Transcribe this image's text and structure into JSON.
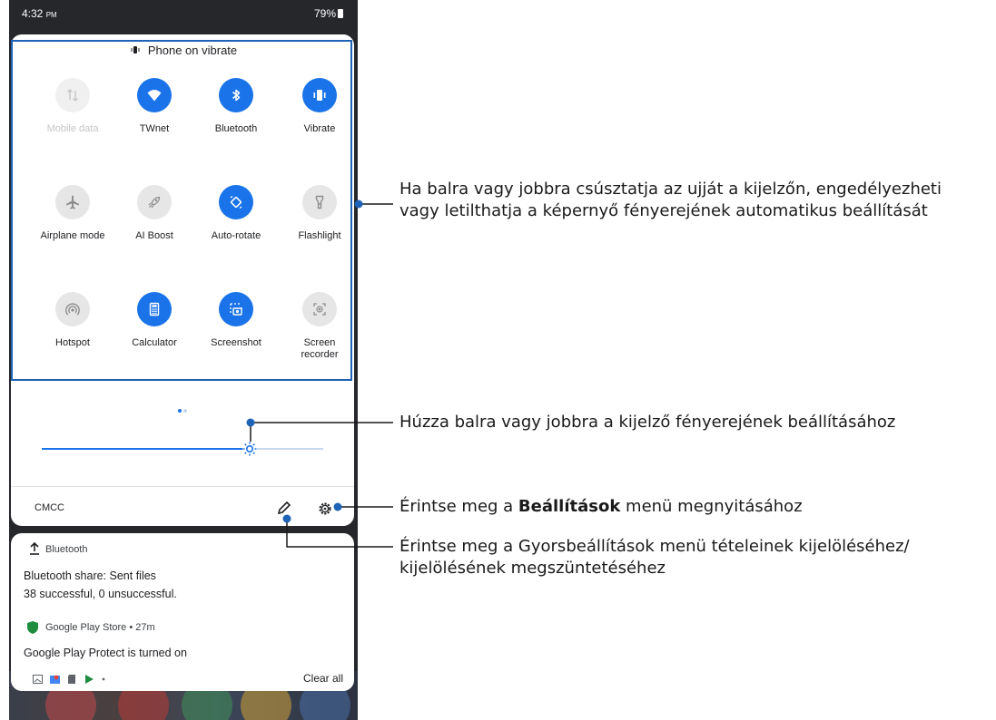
{
  "status_bar": {
    "time": "4:32",
    "ampm": "PM",
    "battery": "79%"
  },
  "quick_settings": {
    "mode_text": "Phone on vibrate",
    "tiles": [
      {
        "label": "Mobile data",
        "icon": "mobile-data-icon",
        "state": "disabled"
      },
      {
        "label": "TWnet",
        "icon": "wifi-icon",
        "state": "on"
      },
      {
        "label": "Bluetooth",
        "icon": "bluetooth-icon",
        "state": "on"
      },
      {
        "label": "Vibrate",
        "icon": "vibrate-icon",
        "state": "on"
      },
      {
        "label": "Airplane mode",
        "icon": "airplane-icon",
        "state": "off"
      },
      {
        "label": "AI Boost",
        "icon": "rocket-icon",
        "state": "off"
      },
      {
        "label": "Auto-rotate",
        "icon": "auto-rotate-icon",
        "state": "on"
      },
      {
        "label": "Flashlight",
        "icon": "flashlight-icon",
        "state": "off"
      },
      {
        "label": "Hotspot",
        "icon": "hotspot-icon",
        "state": "off"
      },
      {
        "label": "Calculator",
        "icon": "calculator-icon",
        "state": "on"
      },
      {
        "label": "Screenshot",
        "icon": "screenshot-icon",
        "state": "on"
      },
      {
        "label": "Screen recorder",
        "icon": "screen-recorder-icon",
        "state": "off"
      }
    ],
    "page_count": 2,
    "current_page": 1,
    "brightness_level": 0.74,
    "carrier": "CMCC"
  },
  "notifications": {
    "bt_app": "Bluetooth",
    "bt_title": "Bluetooth share: Sent files",
    "bt_text": "38 successful, 0 unsuccessful.",
    "gp_app": "Google Play Store • 27m",
    "gp_title": "Google Play Protect is turned on",
    "clear_all": "Clear all"
  },
  "annotations": {
    "swipe_line1": "Ha balra vagy jobbra csúsztatja az ujját a kijelzőn, engedélyezheti",
    "swipe_line2": "vagy letilthatja a képernyő fényerejének automatikus beállítását",
    "brightness": "Húzza balra vagy jobbra a kijelző fényerejének beállításához",
    "settings_pre": "Érintse meg a ",
    "settings_bold": "Beállítások",
    "settings_post": " menü megnyitásához",
    "edit_line1": "Érintse meg a Gyorsbeállítások menü tételeinek kijelöléséhez/",
    "edit_line2": "kijelölésének megszüntetéséhez"
  },
  "colors": {
    "accent": "#1a73e8",
    "callout": "#1f63b6"
  }
}
